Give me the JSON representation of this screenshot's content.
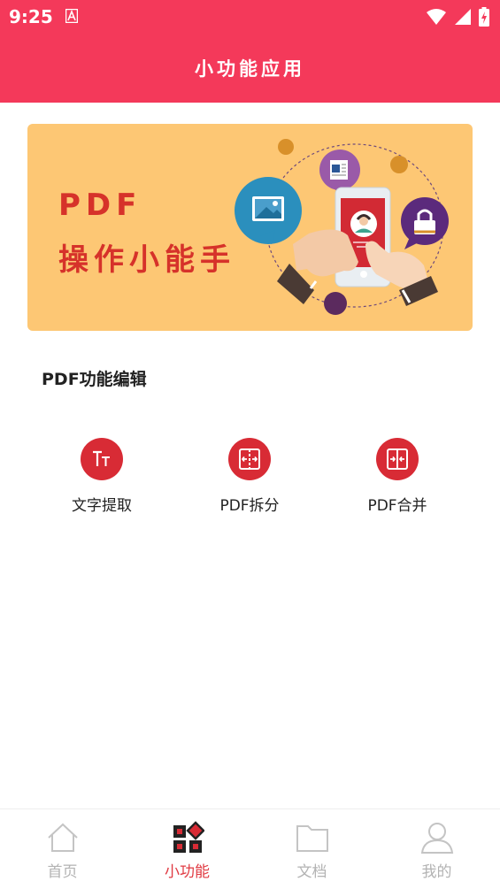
{
  "status_bar": {
    "time": "9:25",
    "icons": [
      "notification-a-icon",
      "wifi-icon",
      "signal-icon",
      "battery-charging-icon"
    ]
  },
  "app_bar": {
    "title": "小功能应用"
  },
  "banner": {
    "line1": "PDF",
    "line2": "操作小能手",
    "colors": {
      "background": "#fdc774",
      "text": "#d6322a"
    }
  },
  "section": {
    "title": "PDF功能编辑"
  },
  "functions": [
    {
      "label": "文字提取",
      "icon": "text-extract-icon"
    },
    {
      "label": "PDF拆分",
      "icon": "split-icon"
    },
    {
      "label": "PDF合并",
      "icon": "merge-icon"
    }
  ],
  "bottom_nav": {
    "items": [
      {
        "label": "首页",
        "icon": "home-icon",
        "active": false
      },
      {
        "label": "小功能",
        "icon": "tools-icon",
        "active": true
      },
      {
        "label": "文档",
        "icon": "folder-icon",
        "active": false
      },
      {
        "label": "我的",
        "icon": "person-icon",
        "active": false
      }
    ]
  },
  "colors": {
    "primary": "#f4395a",
    "accent": "#d82b35",
    "nav_active": "#e03a42",
    "nav_inactive": "#b3b3b3"
  }
}
